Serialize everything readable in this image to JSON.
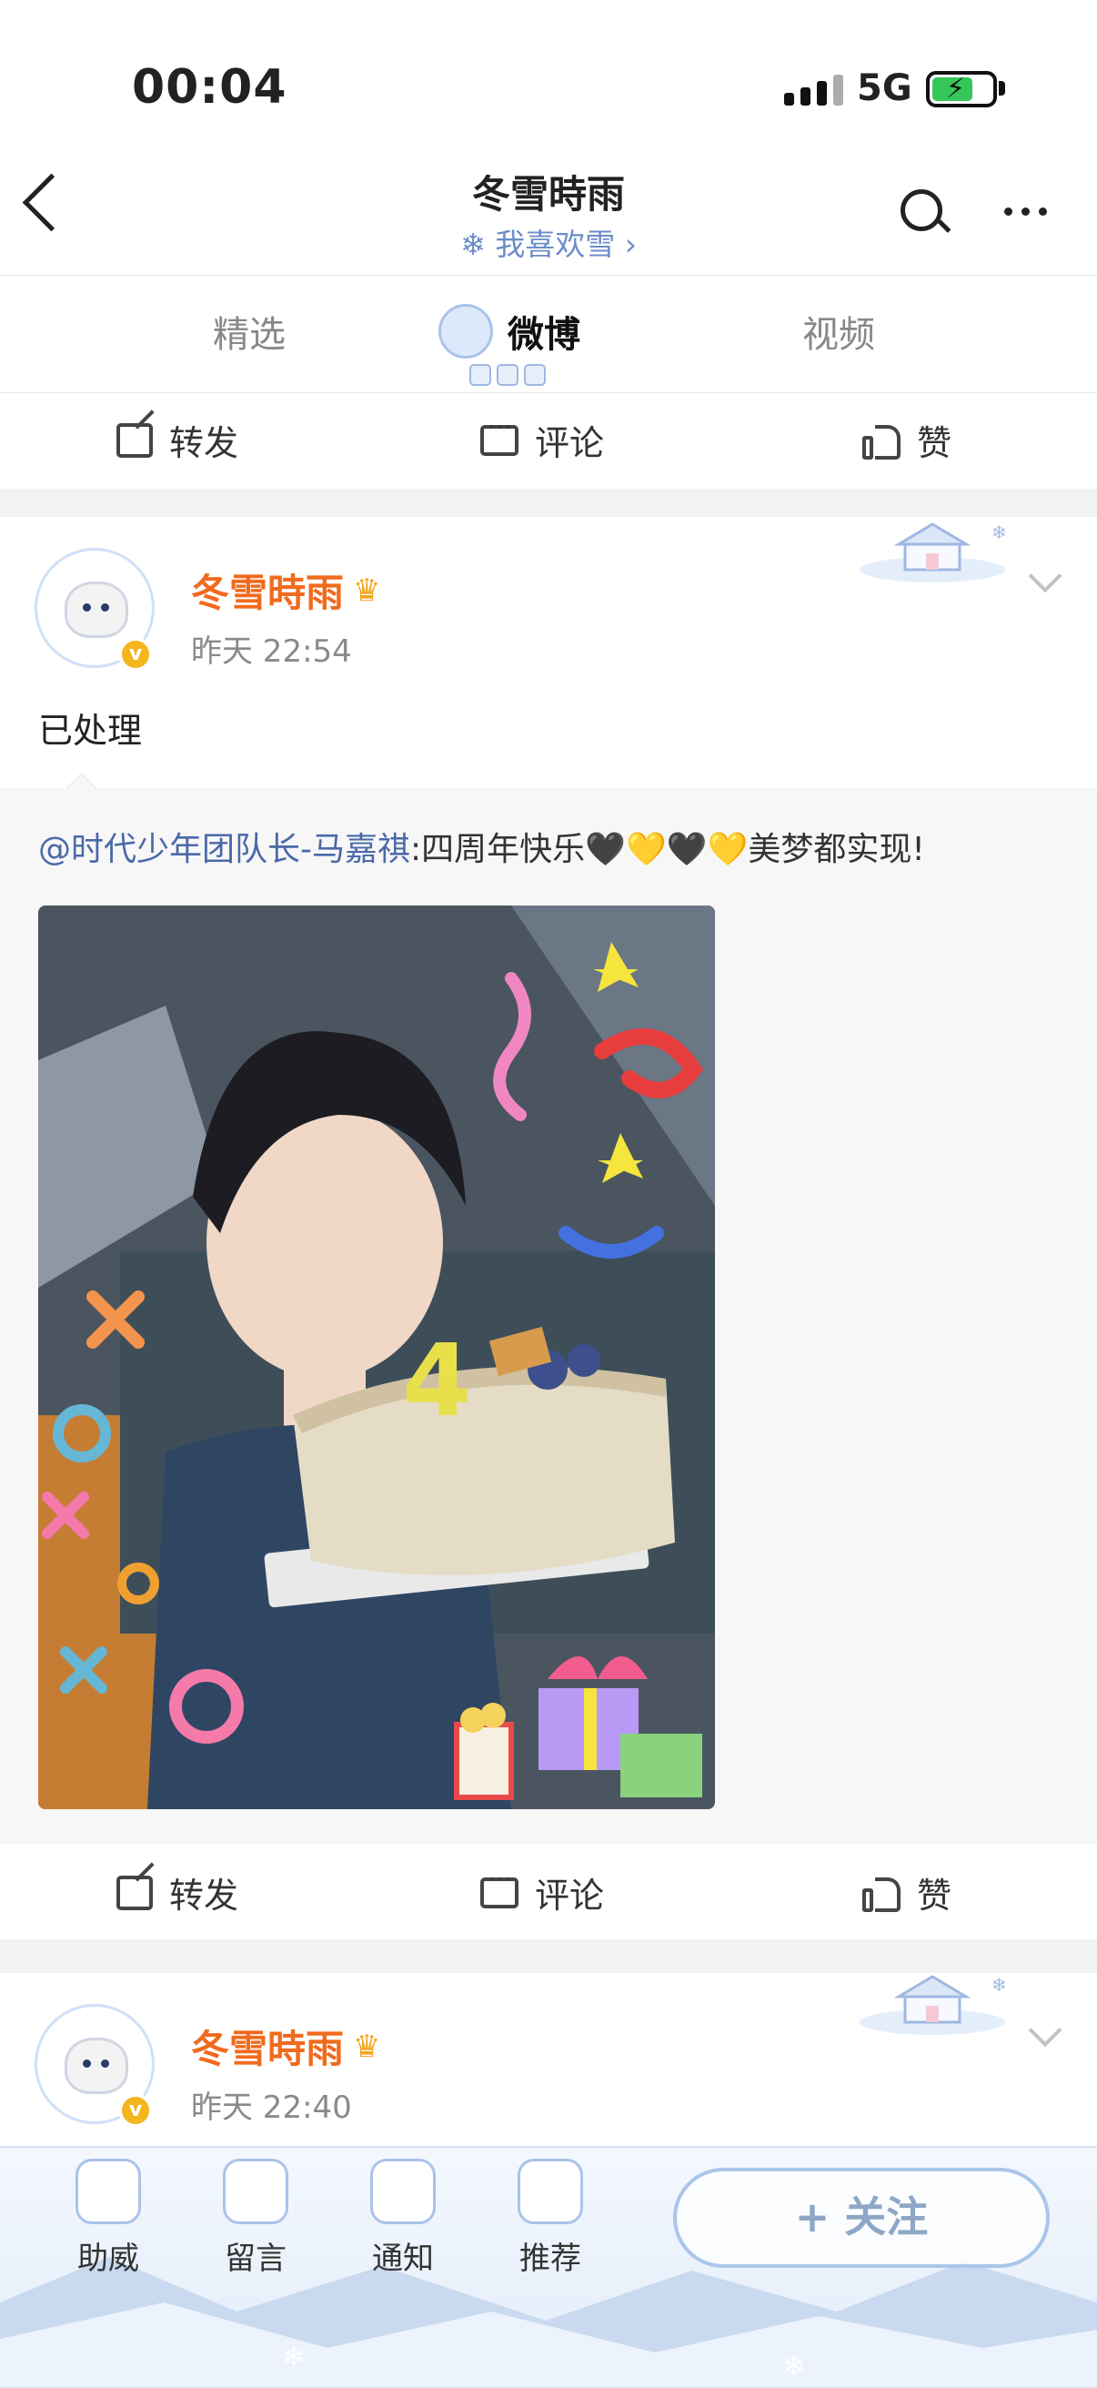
{
  "status_bar": {
    "time": "00:04",
    "network": "5G",
    "battery_level": 0.65
  },
  "header": {
    "title": "冬雪時雨",
    "subtitle": "我喜欢雪"
  },
  "tabs": [
    {
      "label": "精选"
    },
    {
      "label": "微博"
    },
    {
      "label": "视频"
    }
  ],
  "active_tab": "微博",
  "actions": {
    "repost": "转发",
    "comment": "评论",
    "like": "赞"
  },
  "post1": {
    "username": "冬雪時雨",
    "time": "昨天 22:54",
    "text": "已处理",
    "retweet": {
      "mention": "@时代少年团队长-马嘉祺",
      "text": ":四周年快乐🖤💛🖤💛美梦都实现!"
    }
  },
  "post2": {
    "username": "冬雪時雨",
    "time": "昨天 22:40"
  },
  "toolbar": {
    "items": [
      {
        "label": "助威"
      },
      {
        "label": "留言"
      },
      {
        "label": "通知"
      },
      {
        "label": "推荐"
      }
    ],
    "follow": "+ 关注"
  },
  "colors": {
    "username": "#f06b1e",
    "mention": "#4a69a8",
    "accent_blue": "#6b8dc7",
    "battery": "#35c759"
  }
}
